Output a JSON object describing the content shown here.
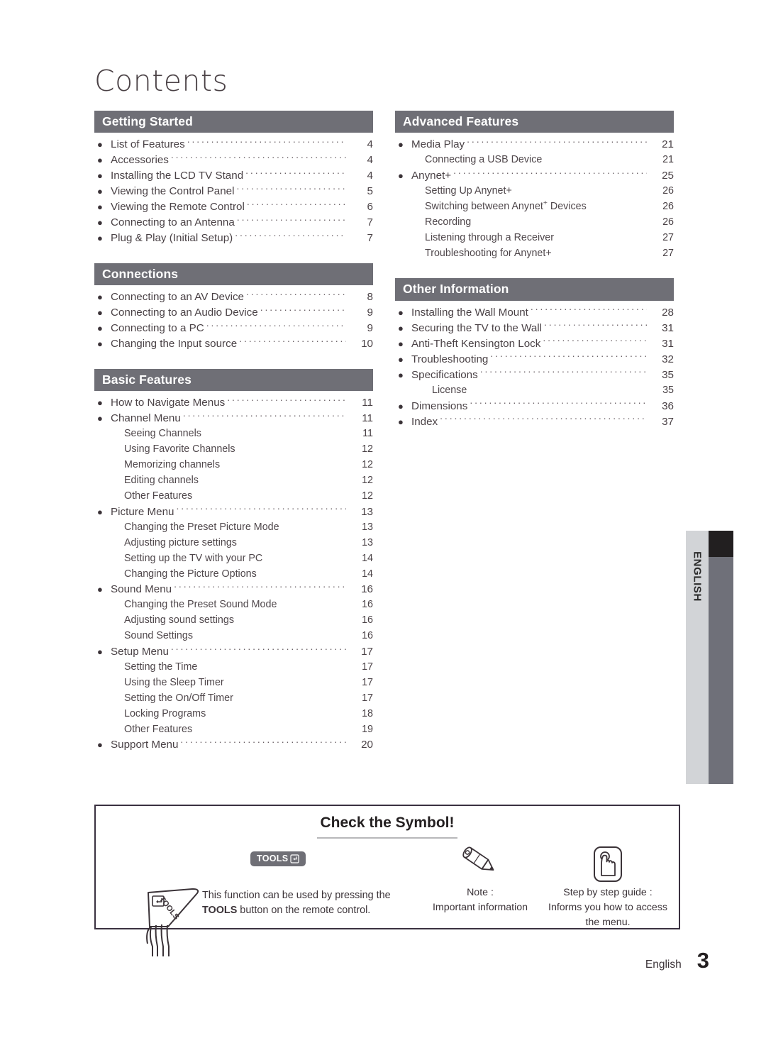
{
  "page_title": "Contents",
  "columns": {
    "left": [
      {
        "header": "Getting Started",
        "items": [
          {
            "level": "top",
            "label": "List of Features",
            "page": "4"
          },
          {
            "level": "top",
            "label": "Accessories",
            "page": "4"
          },
          {
            "level": "top",
            "label": "Installing the LCD TV Stand",
            "page": "4"
          },
          {
            "level": "top",
            "label": "Viewing the Control Panel",
            "page": "5"
          },
          {
            "level": "top",
            "label": "Viewing the Remote Control",
            "page": "6"
          },
          {
            "level": "top",
            "label": "Connecting to an Antenna",
            "page": "7"
          },
          {
            "level": "top",
            "label": "Plug & Play (Initial Setup)",
            "page": "7"
          }
        ]
      },
      {
        "header": "Connections",
        "items": [
          {
            "level": "top",
            "label": "Connecting to an AV Device",
            "page": "8"
          },
          {
            "level": "top",
            "label": "Connecting to an Audio Device",
            "page": "9"
          },
          {
            "level": "top",
            "label": "Connecting to a PC",
            "page": "9"
          },
          {
            "level": "top",
            "label": "Changing the Input source",
            "page": "10"
          }
        ]
      },
      {
        "header": "Basic Features",
        "items": [
          {
            "level": "top",
            "label": "How to Navigate Menus",
            "page": "11"
          },
          {
            "level": "top",
            "label": "Channel Menu",
            "page": "11"
          },
          {
            "level": "sub",
            "label": "Seeing Channels",
            "page": "11"
          },
          {
            "level": "sub",
            "label": "Using Favorite Channels",
            "page": "12"
          },
          {
            "level": "sub",
            "label": "Memorizing channels",
            "page": "12"
          },
          {
            "level": "sub",
            "label": "Editing channels",
            "page": "12"
          },
          {
            "level": "sub",
            "label": "Other Features",
            "page": "12"
          },
          {
            "level": "top",
            "label": "Picture Menu",
            "page": "13"
          },
          {
            "level": "sub",
            "label": "Changing the Preset Picture Mode",
            "page": "13"
          },
          {
            "level": "sub",
            "label": "Adjusting picture settings",
            "page": "13"
          },
          {
            "level": "sub",
            "label": "Setting up the TV with your PC",
            "page": "14"
          },
          {
            "level": "sub",
            "label": "Changing the Picture Options",
            "page": "14"
          },
          {
            "level": "top",
            "label": "Sound Menu",
            "page": "16"
          },
          {
            "level": "sub",
            "label": "Changing the Preset Sound Mode",
            "page": "16"
          },
          {
            "level": "sub",
            "label": "Adjusting sound settings",
            "page": "16"
          },
          {
            "level": "sub",
            "label": "Sound Settings",
            "page": "16"
          },
          {
            "level": "top",
            "label": "Setup Menu",
            "page": "17"
          },
          {
            "level": "sub",
            "label": "Setting the Time",
            "page": "17"
          },
          {
            "level": "sub",
            "label": "Using the Sleep Timer",
            "page": "17"
          },
          {
            "level": "sub",
            "label": "Setting the On/Off Timer",
            "page": "17"
          },
          {
            "level": "sub",
            "label": "Locking Programs",
            "page": "18"
          },
          {
            "level": "sub",
            "label": "Other Features",
            "page": "19"
          },
          {
            "level": "top",
            "label": "Support Menu",
            "page": "20"
          }
        ]
      }
    ],
    "right": [
      {
        "header": "Advanced Features",
        "items": [
          {
            "level": "top",
            "label": "Media Play",
            "page": "21"
          },
          {
            "level": "sub",
            "label": "Connecting a USB Device",
            "page": "21"
          },
          {
            "level": "top",
            "label": "Anynet+",
            "page": "25"
          },
          {
            "level": "sub",
            "label": "Setting Up Anynet+",
            "page": "26"
          },
          {
            "level": "sub",
            "label": "Switching between Anynet+ Devices",
            "page": "26",
            "superscript_plus": true
          },
          {
            "level": "sub",
            "label": "Recording",
            "page": "26"
          },
          {
            "level": "sub",
            "label": "Listening through a Receiver",
            "page": "27"
          },
          {
            "level": "sub",
            "label": "Troubleshooting for Anynet+",
            "page": "27"
          }
        ]
      },
      {
        "header": "Other Information",
        "items": [
          {
            "level": "top",
            "label": "Installing the Wall Mount",
            "page": "28"
          },
          {
            "level": "top",
            "label": "Securing the TV to the Wall",
            "page": "31"
          },
          {
            "level": "top",
            "label": "Anti-Theft Kensington Lock",
            "page": "31"
          },
          {
            "level": "top",
            "label": "Troubleshooting",
            "page": "32"
          },
          {
            "level": "top",
            "label": "Specifications",
            "page": "35"
          },
          {
            "level": "sub",
            "deep": true,
            "label": "License",
            "page": "35"
          },
          {
            "level": "top",
            "label": "Dimensions",
            "page": "36"
          },
          {
            "level": "top",
            "label": "Index",
            "page": "37"
          }
        ]
      }
    ]
  },
  "side_tab": {
    "label": "ENGLISH"
  },
  "symbol_box": {
    "title": "Check the Symbol!",
    "tools": {
      "badge_label": "TOOLS",
      "text_before": "This function can be used by pressing the ",
      "text_bold": "TOOLS",
      "text_after": " button on the remote control.",
      "remote_label": "TOOLS"
    },
    "note": {
      "caption_line1": "Note :",
      "caption_line2": "Important information"
    },
    "step": {
      "caption_line1": "Step by step guide :",
      "caption_line2": "Informs you how to access the menu."
    }
  },
  "footer": {
    "language": "English",
    "page_number": "3"
  },
  "colors": {
    "section_header_bg": "#6f6f76",
    "tab_light": "#d2d4d7",
    "tab_dark": "#6f7079",
    "tab_cap": "#221f20",
    "box_border": "#3a3140",
    "text": "#3b3338"
  }
}
